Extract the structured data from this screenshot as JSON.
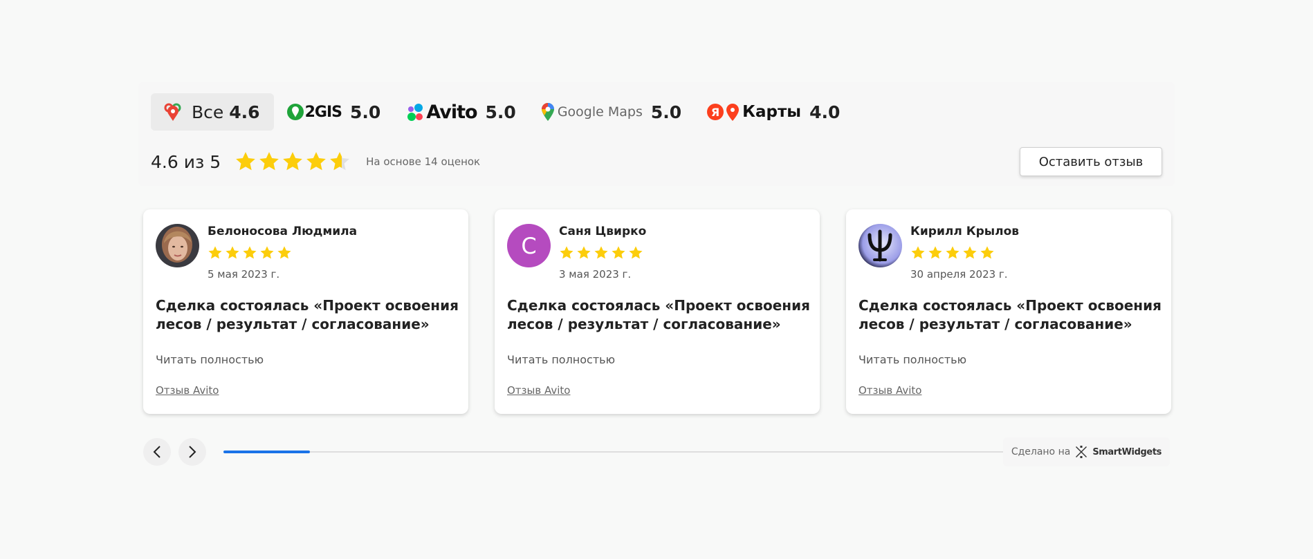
{
  "tabs": [
    {
      "word": "Все",
      "rating": "4.6",
      "icon": "all-sources-icon",
      "active": true
    },
    {
      "word": "2GIS",
      "rating": "5.0",
      "icon": "2gis-logo-icon"
    },
    {
      "word": "Avito",
      "rating": "5.0",
      "icon": "avito-logo-icon"
    },
    {
      "word": "Google Maps",
      "rating": "5.0",
      "icon": "google-maps-pin-icon"
    },
    {
      "word": "Карты",
      "rating": "4.0",
      "icon": "yandex-maps-icon"
    }
  ],
  "summary": {
    "rating_text": "4.6 из 5",
    "rating_value": 4.6,
    "based_on": "На основе 14 оценок",
    "leave_review": "Оставить отзыв"
  },
  "reviews": [
    {
      "author": "Белоносова Людмила",
      "stars": 5,
      "date": "5 мая 2023 г.",
      "title": "Сделка состоялась «Проект освоения лесов / результат / согласование»",
      "read_more": "Читать полностью",
      "source": "Отзыв Avito",
      "avatar": "photo"
    },
    {
      "author": "Саня Цвирко",
      "stars": 5,
      "date": "3 мая 2023 г.",
      "title": "Сделка состоялась «Проект освоения лесов / результат / согласование»",
      "read_more": "Читать полностью",
      "source": "Отзыв Avito",
      "avatar": "letter",
      "avatar_letter": "С"
    },
    {
      "author": "Кирилл Крылов",
      "stars": 5,
      "date": "30 апреля 2023 г.",
      "title": "Сделка состоялась «Проект освоения лесов / результат / согласование»",
      "read_more": "Читать полностью",
      "source": "Отзыв Avito",
      "avatar": "psi"
    }
  ],
  "carousel": {
    "progress_fraction": 0.11
  },
  "footer": {
    "made_with": "Сделано на",
    "brand": "SmartWidgets"
  },
  "colors": {
    "star": "#fccd0b",
    "star_empty": "#e0e0e0",
    "accent": "#1a73e8",
    "avatar_letter_bg": "#b54bbf"
  }
}
